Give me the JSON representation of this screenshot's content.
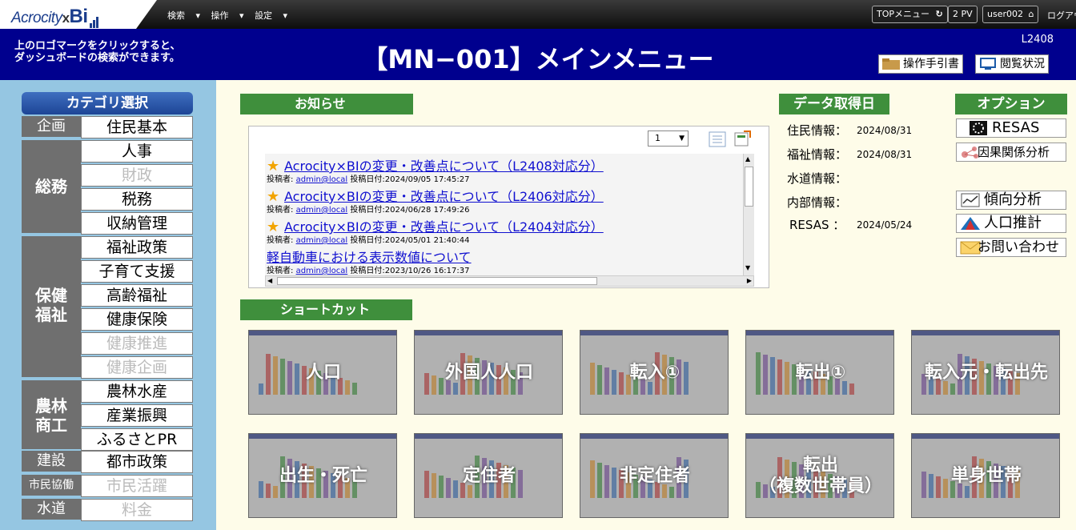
{
  "topbar": {
    "logo": "Acrocity×BI",
    "menus": [
      "検索",
      "操作",
      "設定"
    ],
    "top_menu": "TOPメニュー",
    "pv": "2 PV",
    "user": "user002",
    "logout": "ログアウ"
  },
  "header": {
    "hint_line1": "上のロゴマークをクリックすると、",
    "hint_line2": "ダッシュボードの検索ができます。",
    "title": "【MN−001】メインメニュー",
    "version": "L2408",
    "manual": "操作手引書",
    "view_status": "閲覧状況"
  },
  "sidebar": {
    "title": "カテゴリ選択",
    "groups": [
      {
        "label": "企画",
        "items": [
          {
            "label": "住民基本",
            "enabled": true
          }
        ]
      },
      {
        "label": "総務",
        "items": [
          {
            "label": "人事",
            "enabled": true
          },
          {
            "label": "財政",
            "enabled": false
          },
          {
            "label": "税務",
            "enabled": true
          },
          {
            "label": "収納管理",
            "enabled": true
          }
        ]
      },
      {
        "label": "保健福祉",
        "items": [
          {
            "label": "福祉政策",
            "enabled": true
          },
          {
            "label": "子育て支援",
            "enabled": true
          },
          {
            "label": "高齢福祉",
            "enabled": true
          },
          {
            "label": "健康保険",
            "enabled": true
          },
          {
            "label": "健康推進",
            "enabled": false
          },
          {
            "label": "健康企画",
            "enabled": false
          }
        ]
      },
      {
        "label": "農林商工",
        "items": [
          {
            "label": "農林水産",
            "enabled": true
          },
          {
            "label": "産業振興",
            "enabled": true
          },
          {
            "label": "ふるさとPR",
            "enabled": true
          }
        ]
      },
      {
        "label": "建設",
        "items": [
          {
            "label": "都市政策",
            "enabled": true
          }
        ]
      },
      {
        "label": "市民協働",
        "items": [
          {
            "label": "市民活躍",
            "enabled": false
          }
        ]
      },
      {
        "label": "水道",
        "items": [
          {
            "label": "料金",
            "enabled": false
          }
        ]
      }
    ]
  },
  "notices": {
    "title": "お知らせ",
    "page": "1",
    "items": [
      {
        "title": "Acrocity×BIの変更・改善点について（L2408対応分）",
        "poster_label": "投稿者:",
        "poster": "admin@local",
        "date_label": "投稿日付:",
        "date": "2024/09/05 17:45:27",
        "starred": true
      },
      {
        "title": "Acrocity×BIの変更・改善点について（L2406対応分）",
        "poster_label": "投稿者:",
        "poster": "admin@local",
        "date_label": "投稿日付:",
        "date": "2024/06/28 17:49:26",
        "starred": true
      },
      {
        "title": "Acrocity×BIの変更・改善点について（L2404対応分）",
        "poster_label": "投稿者:",
        "poster": "admin@local",
        "date_label": "投稿日付:",
        "date": "2024/05/01 21:40:44",
        "starred": true
      },
      {
        "title": "軽自動車における表示数値について",
        "poster_label": "投稿者:",
        "poster": "admin@local",
        "date_label": "投稿日付:",
        "date": "2023/10/26 16:17:37",
        "starred": false
      }
    ]
  },
  "data_dates": {
    "title": "データ取得日",
    "items": [
      {
        "label": "住民情報",
        "value": "2024/08/31"
      },
      {
        "label": "福祉情報",
        "value": "2024/08/31"
      },
      {
        "label": "水道情報",
        "value": ""
      },
      {
        "label": "内部情報",
        "value": ""
      },
      {
        "label": "RESAS",
        "value": "2024/05/24"
      }
    ]
  },
  "options": {
    "title": "オプション",
    "items": [
      "RESAS",
      "因果関係分析",
      "傾向分析",
      "人口推計",
      "お問い合わせ"
    ]
  },
  "shortcuts": {
    "title": "ショートカット",
    "row1": [
      "人口",
      "外国人人口",
      "転入①",
      "転出①",
      "転入元・転出先"
    ],
    "row2": [
      "出生・死亡",
      "定住者",
      "非定住者",
      "転出\n（複数世帯員）",
      "単身世帯"
    ]
  },
  "colors": {
    "header_bg": "#00008e",
    "sidebar_bg": "#95c6e2",
    "section_green": "#3f8f3c",
    "group_gray": "#6f6f6f",
    "link_blue": "#1010d0"
  }
}
